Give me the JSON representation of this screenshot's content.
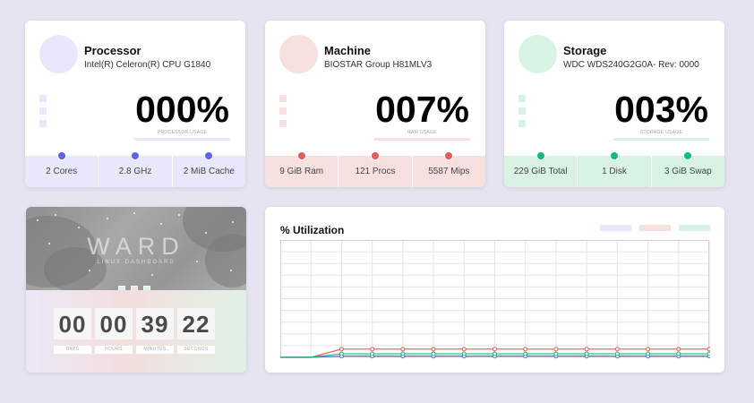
{
  "colors": {
    "cpu": "#5f63e0",
    "ram": "#e85a5a",
    "storage": "#10bb83",
    "cpu_soft": "#e7e8fb",
    "ram_soft": "#f6e0e0",
    "storage_soft": "#d8f2e3"
  },
  "processor": {
    "title": "Processor",
    "subtitle": "Intel(R) Celeron(R) CPU G1840",
    "value": "000%",
    "bar_label": "PROCESSOR USAGE",
    "stats": [
      "2 Cores",
      "2.8 GHz",
      "2 MiB Cache"
    ]
  },
  "machine": {
    "title": "Machine",
    "subtitle": "BIOSTAR Group H81MLV3",
    "value": "007%",
    "bar_label": "RAM USAGE",
    "stats": [
      "9 GiB Ram",
      "121 Procs",
      "5587 Mips"
    ]
  },
  "storage": {
    "title": "Storage",
    "subtitle": "WDC WDS240G2G0A- Rev: 0000",
    "value": "003%",
    "bar_label": "STORAGE USAGE",
    "stats": [
      "229 GiB Total",
      "1 Disk",
      "3 GiB Swap"
    ]
  },
  "ward": {
    "title": "WARD",
    "subtitle": "LINUX DASHBOARD",
    "timer": [
      {
        "value": "00",
        "label": "DAYS"
      },
      {
        "value": "00",
        "label": "HOURS"
      },
      {
        "value": "39",
        "label": "MINUTES"
      },
      {
        "value": "22",
        "label": "SECONDS"
      }
    ]
  },
  "utilization": {
    "title": "% Utilization"
  },
  "chart_data": {
    "type": "line",
    "title": "% Utilization",
    "ylim": [
      0,
      100
    ],
    "grid": true,
    "x": [
      0,
      1,
      2,
      3,
      4,
      5,
      6,
      7,
      8,
      9,
      10,
      11,
      12,
      13,
      14
    ],
    "series": [
      {
        "color": "#5f63e0",
        "values": [
          0,
          0,
          1,
          1,
          1,
          1,
          1,
          1,
          1,
          1,
          1,
          1,
          1,
          1,
          1
        ]
      },
      {
        "color": "#e85a5a",
        "values": [
          0,
          0,
          7,
          7,
          7,
          7,
          7,
          7,
          7,
          7,
          7,
          7,
          7,
          7,
          7
        ]
      },
      {
        "color": "#10bb83",
        "values": [
          0,
          0,
          3,
          3,
          3,
          3,
          3,
          3,
          3,
          3,
          3,
          3,
          3,
          3,
          3
        ]
      }
    ]
  }
}
